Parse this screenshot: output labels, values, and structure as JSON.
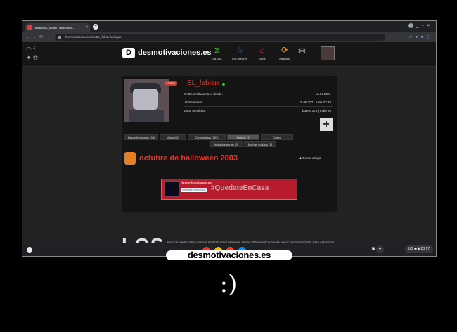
{
  "browser": {
    "tab_title": "Usuario EL_fabian | Desmotiva...",
    "url": "desmotivaciones.es/u/EL_fabian/amigos"
  },
  "site": {
    "logo_letter": "D",
    "logo_text": "desmotivaciones.es",
    "menu": [
      {
        "label": "La cola",
        "icon": "hourglass-icon",
        "glyph": "⧖",
        "color": "#3ccf3c"
      },
      {
        "label": "Los mejores",
        "icon": "star-icon",
        "glyph": "☆",
        "color": "#2196f3"
      },
      {
        "label": "Sube",
        "icon": "home-upload-icon",
        "glyph": "⌂",
        "color": "#e91e63"
      },
      {
        "label": "Aleatorio",
        "icon": "refresh-icon",
        "glyph": "⟳",
        "color": "#ff9800"
      }
    ]
  },
  "profile": {
    "rank": "#29559",
    "username": "EL_fabian",
    "stats": [
      {
        "label": "En Desmotivaciones desde:",
        "value": "12.04.2021"
      },
      {
        "label": "Última sesión:",
        "value": "29.06.2021 a las 22:49"
      },
      {
        "label": "Votos recibidos:",
        "value": "bueno 175 | malo 26"
      }
    ],
    "tabs": [
      "Desmotivaciones (43)",
      "Votos (52)",
      "Comentarios (293)",
      "Amigos (1)",
      "Correo"
    ],
    "subtabs": [
      "Invitados por mí (0)",
      "Me han invitado (1)"
    ],
    "friend_name": "octubre de halloween 2003",
    "delete_friend": "Borrar amigo",
    "plus": "+"
  },
  "banner": {
    "site": "desmotivaciones.es",
    "fb_like": "Me gusta esta página",
    "tag": "#QuedateEnCasa"
  },
  "footer": {
    "big_word": "LOS",
    "tags": "abrazos alegria alma amigos amistad amor animales anime arte ausencia ayuda besos bogota caracter casa celos cine comida confianza corazon chiste criticas debilidad"
  },
  "taskbar": {
    "locale": "US",
    "time": "23:17"
  },
  "watermark": "desmotivaciones.es",
  "caption": ":)"
}
